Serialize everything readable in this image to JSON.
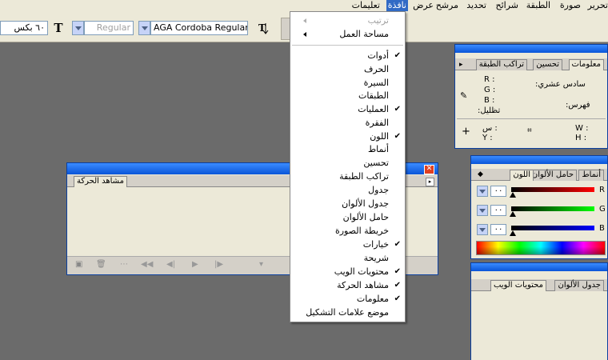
{
  "menubar": {
    "items": [
      {
        "label": "تحرير",
        "active": false
      },
      {
        "label": "صورة",
        "active": false
      },
      {
        "label": "الطبقة",
        "active": false
      },
      {
        "label": "شرائح",
        "active": false
      },
      {
        "label": "تحديد",
        "active": false
      },
      {
        "label": "مرشح",
        "active": false
      },
      {
        "label": "عرض",
        "active": false
      },
      {
        "label": "نافذة",
        "active": true
      },
      {
        "label": "تعليمات",
        "active": false
      }
    ]
  },
  "options_bar": {
    "font_family": "AGA Cordoba Regular",
    "font_style": "Regular",
    "font_size": "٦٠ بكس"
  },
  "window_menu": {
    "items": [
      {
        "label": "ترتيب",
        "checked": false,
        "submenu": true,
        "disabled": true
      },
      {
        "label": "مساحة العمل",
        "checked": false,
        "submenu": true,
        "disabled": false
      },
      {
        "label": "أدوات",
        "checked": true,
        "submenu": false,
        "disabled": false
      },
      {
        "label": "الحرف",
        "checked": false,
        "submenu": false,
        "disabled": false
      },
      {
        "label": "السيرة",
        "checked": false,
        "submenu": false,
        "disabled": false
      },
      {
        "label": "الطبقات",
        "checked": false,
        "submenu": false,
        "disabled": false
      },
      {
        "label": "العمليات",
        "checked": true,
        "submenu": false,
        "disabled": false
      },
      {
        "label": "الفقرة",
        "checked": false,
        "submenu": false,
        "disabled": false
      },
      {
        "label": "اللون",
        "checked": true,
        "submenu": false,
        "disabled": false
      },
      {
        "label": "أنماط",
        "checked": false,
        "submenu": false,
        "disabled": false
      },
      {
        "label": "تحسين",
        "checked": false,
        "submenu": false,
        "disabled": false
      },
      {
        "label": "تراكب الطبقة",
        "checked": false,
        "submenu": false,
        "disabled": false
      },
      {
        "label": "جدول",
        "checked": false,
        "submenu": false,
        "disabled": false
      },
      {
        "label": "جدول الألوان",
        "checked": false,
        "submenu": false,
        "disabled": false
      },
      {
        "label": "حامل الألوان",
        "checked": false,
        "submenu": false,
        "disabled": false
      },
      {
        "label": "خريطة الصورة",
        "checked": false,
        "submenu": false,
        "disabled": false
      },
      {
        "label": "خيارات",
        "checked": true,
        "submenu": false,
        "disabled": false
      },
      {
        "label": "شريحة",
        "checked": false,
        "submenu": false,
        "disabled": false
      },
      {
        "label": "محتويات الويب",
        "checked": true,
        "submenu": false,
        "disabled": false
      },
      {
        "label": "مشاهد الحركة",
        "checked": true,
        "submenu": false,
        "disabled": false
      },
      {
        "label": "معلومات",
        "checked": true,
        "submenu": false,
        "disabled": false
      },
      {
        "label": "موضع علامات التشكيل",
        "checked": false,
        "submenu": false,
        "disabled": false
      }
    ]
  },
  "animation_panel": {
    "tab": "مشاهد الحركة"
  },
  "info_panel": {
    "tabs": [
      "معلومات",
      "تحسين",
      "تراكب الطبقة"
    ],
    "r": "R :",
    "g": "G :",
    "b": "B :",
    "hex_label": "سادس عشري:",
    "index_label": "فهرس:",
    "opacity_label": "تظليل:",
    "x": "س :",
    "y": "Y :",
    "w": "W :",
    "h": "H :"
  },
  "color_panel": {
    "tabs": [
      "اللون",
      "حامل الألوان",
      "أنماط"
    ],
    "channels": [
      {
        "name": "R",
        "value": "٠٠",
        "color": "#ff0000"
      },
      {
        "name": "G",
        "value": "٠٠",
        "color": "#00ff00"
      },
      {
        "name": "B",
        "value": "٠٠",
        "color": "#0000ff"
      }
    ]
  },
  "web_panel": {
    "tabs": [
      "جدول الألوان",
      "محتويات الويب"
    ]
  }
}
